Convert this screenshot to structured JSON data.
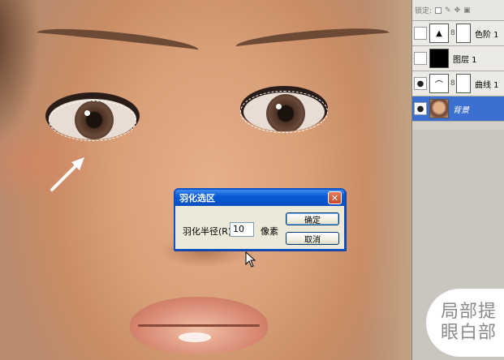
{
  "layers_panel": {
    "lock_label": "锁定:",
    "layers": [
      {
        "name": "色阶 1",
        "visible": false,
        "thumb": "levels-icon",
        "has_mask": true,
        "selected": false
      },
      {
        "name": "图层 1",
        "visible": false,
        "thumb": "black-fill",
        "has_mask": false,
        "selected": false
      },
      {
        "name": "曲线 1",
        "visible": true,
        "thumb": "curves-icon",
        "has_mask": true,
        "selected": false
      },
      {
        "name": "背景",
        "visible": true,
        "thumb": "photo",
        "has_mask": false,
        "selected": true
      }
    ]
  },
  "callout": {
    "line1": "局部提",
    "line2": "眼白部"
  },
  "dialog": {
    "title": "羽化选区",
    "radius_label": "羽化半径(R):",
    "radius_value": "10",
    "unit": "像素",
    "ok_label": "确定",
    "cancel_label": "取消",
    "close_glyph": "✕"
  },
  "colors": {
    "titlebar": "#0a54c8",
    "selected_layer": "#3b6fd0",
    "dialog_bg": "#ece9d8"
  }
}
